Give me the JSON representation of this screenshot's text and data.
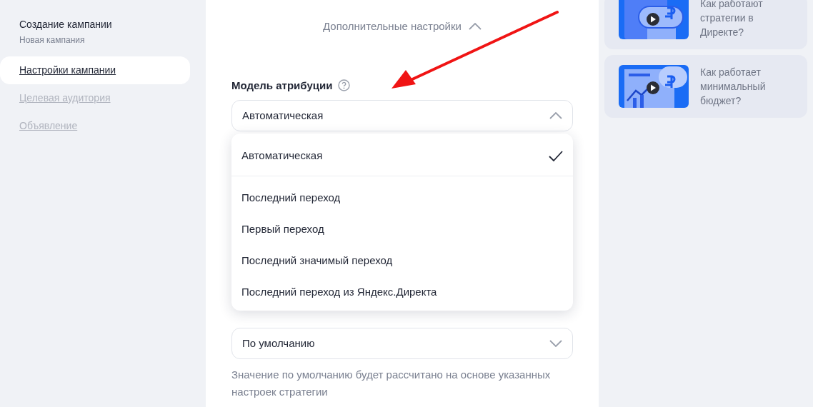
{
  "sidebar": {
    "title": "Создание кампании",
    "subtitle": "Новая кампания",
    "items": [
      {
        "label": "Настройки кампании",
        "selected": true
      },
      {
        "label": "Целевая аудитория",
        "selected": false
      },
      {
        "label": "Объявление",
        "selected": false
      }
    ]
  },
  "advanced_toggle": {
    "label": "Дополнительные настройки",
    "expanded": true
  },
  "attribution": {
    "label": "Модель атрибуции",
    "value": "Автоматическая",
    "expanded": true,
    "options": [
      {
        "label": "Автоматическая",
        "selected": true
      },
      {
        "label": "Последний переход",
        "selected": false
      },
      {
        "label": "Первый переход",
        "selected": false
      },
      {
        "label": "Последний значимый переход",
        "selected": false
      },
      {
        "label": "Последний переход из Яндекс.Директа",
        "selected": false
      }
    ]
  },
  "second_select": {
    "value": "По умолчанию",
    "expanded": false
  },
  "hint": "Значение по умолчанию будет рассчитано на основе указанных настроек стратегии",
  "videos": [
    {
      "title": "Как работают стратегии в Директе?",
      "kind": "coin"
    },
    {
      "title": "Как работает минимальный бюджет?",
      "kind": "chart"
    }
  ]
}
